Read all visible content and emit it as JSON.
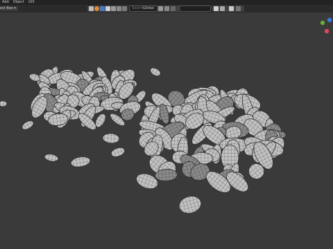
{
  "menubar": {
    "items": [
      "Add",
      "Object",
      "GIS"
    ]
  },
  "toolbar": {
    "select_mode": "ect Box",
    "transform_orientation": "Global",
    "search_placeholder": "Search"
  },
  "colors": {
    "background": "#3a3a3a",
    "menubar": "#232323",
    "toolbar": "#2b2b2b",
    "stone_fill": "#bfbfbf",
    "stone_wire": "#3a3a3a",
    "gizmo_x": "#d94a5a",
    "gizmo_y": "#6aaa3a",
    "gizmo_z": "#3a7ad9"
  },
  "icons": [
    "select-icon",
    "snap-icon",
    "proportional-icon",
    "overlay-icon",
    "filter-icon",
    "funnel-icon",
    "dropdown-icon"
  ],
  "viewport": {
    "content": "3D viewport showing two piles of wireframe stone meshes"
  }
}
